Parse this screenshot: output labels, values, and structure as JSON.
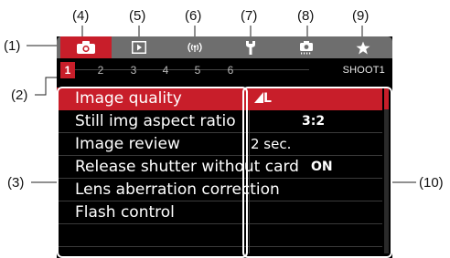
{
  "callouts": {
    "c1": "(1)",
    "c2": "(2)",
    "c3": "(3)",
    "c4": "(4)",
    "c5": "(5)",
    "c6": "(6)",
    "c7": "(7)",
    "c8": "(8)",
    "c9": "(9)",
    "c10": "(10)"
  },
  "tabs": [
    {
      "icon": "camera-icon",
      "active": true
    },
    {
      "icon": "playback-icon",
      "active": false
    },
    {
      "icon": "wireless-icon",
      "active": false
    },
    {
      "icon": "wrench-icon",
      "active": false
    },
    {
      "icon": "custom-function-camera-icon",
      "active": false
    },
    {
      "icon": "star-icon",
      "active": false
    }
  ],
  "pages": [
    "1",
    "2",
    "3",
    "4",
    "5",
    "6"
  ],
  "section_label": "SHOOT1",
  "menu": {
    "items": [
      {
        "label": "Image quality",
        "value": "L",
        "value_prefix_icon": "quality-triangle-icon",
        "selected": true
      },
      {
        "label": "Still img aspect ratio",
        "value": "3:2",
        "selected": false
      },
      {
        "label": "Image review",
        "value": "2 sec.",
        "selected": false
      },
      {
        "label": "Release shutter without card",
        "value": "ON",
        "selected": false
      },
      {
        "label": "Lens aberration correction",
        "value": "",
        "selected": false
      },
      {
        "label": "Flash control",
        "value": "",
        "selected": false
      }
    ]
  },
  "colors": {
    "accent": "#c81e2a",
    "tab_bar": "#6e6e6e",
    "screen_bg": "#000000"
  }
}
